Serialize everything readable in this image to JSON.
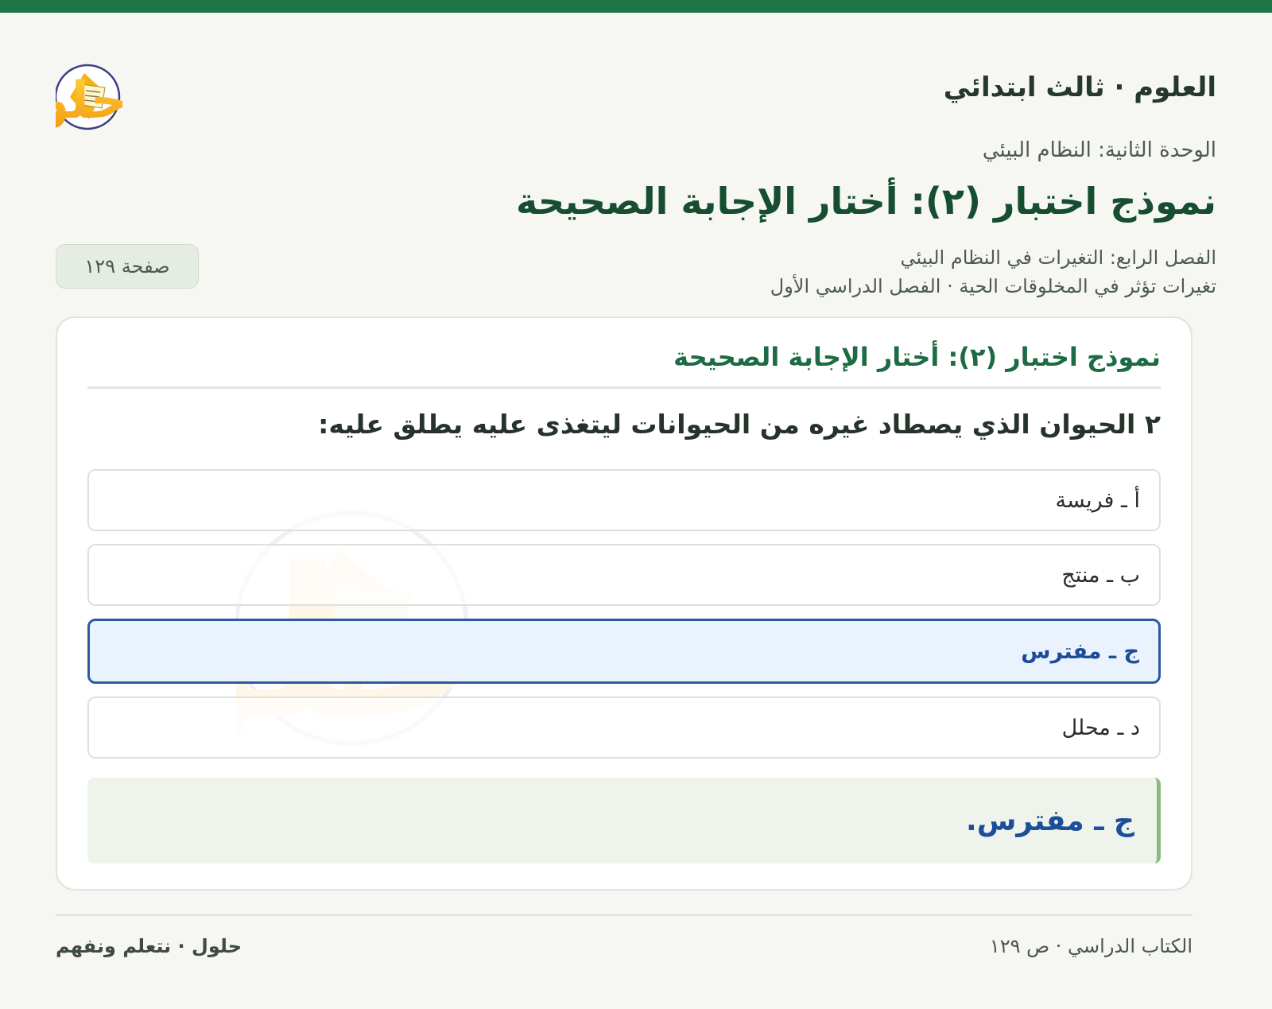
{
  "header": {
    "subject": "العلوم · ثالث ابتدائي",
    "logo_text": "حلول"
  },
  "unit": "الوحدة الثانية: النظام البيئي",
  "main_title": "نموذج اختبار (٢): أختار الإجابة الصحيحة",
  "chapter": {
    "line1": "الفصل الرابع: التغيرات في النظام البيئي",
    "line2": "تغيرات تؤثر في المخلوقات الحية · الفصل الدراسي الأول"
  },
  "page_badge": "صفحة ١٢٩",
  "card": {
    "title": "نموذج اختبار (٢): أختار الإجابة الصحيحة",
    "question": "٢ الحيوان الذي يصطاد غيره من الحيوانات ليتغذى عليه يطلق عليه:",
    "options": [
      {
        "label": "أ ـ فريسة",
        "selected": false
      },
      {
        "label": "ب ـ منتج",
        "selected": false
      },
      {
        "label": "ج ـ مفترس",
        "selected": true
      },
      {
        "label": "د ـ محلل",
        "selected": false
      }
    ],
    "answer": "ج ـ مفترس."
  },
  "footer": {
    "right": "الكتاب الدراسي · ص ١٢٩",
    "left": "حلول · نتعلم ونفهم"
  },
  "colors": {
    "accent_green": "#1e7548",
    "selected_blue": "#2b5a9f",
    "logo_orange": "#f2a516"
  }
}
